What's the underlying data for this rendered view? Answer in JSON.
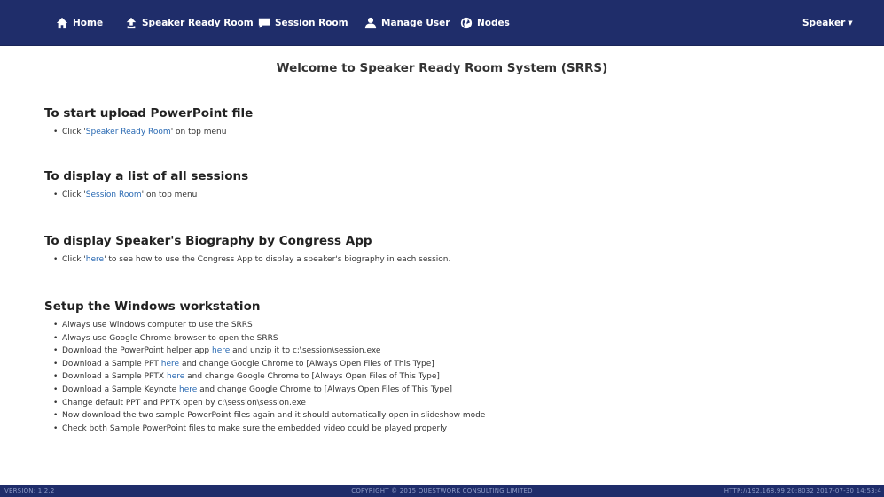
{
  "nav": {
    "home": "Home",
    "speaker_ready_room": "Speaker Ready Room",
    "session_room": "Session Room",
    "manage_user": "Manage User",
    "nodes": "Nodes",
    "user_menu": "Speaker"
  },
  "welcome": "Welcome to Speaker Ready Room System (SRRS)",
  "sections": {
    "upload": {
      "title": "To start upload PowerPoint file",
      "item_pre": "Click '",
      "item_link": "Speaker Ready Room",
      "item_post": "' on top menu"
    },
    "sessions": {
      "title": "To display a list of all sessions",
      "item_pre": "Click '",
      "item_link": "Session Room",
      "item_post": "' on top menu"
    },
    "biography": {
      "title": "To display Speaker's Biography by Congress App",
      "item_pre": "Click '",
      "item_link": "here",
      "item_post": "' to see how to use the Congress App to display a speaker's biography in each session."
    },
    "setup": {
      "title": "Setup the Windows workstation",
      "item1": "Always use Windows computer to use the SRRS",
      "item2": "Always use Google Chrome browser to open the SRRS",
      "item3_pre": "Download the PowerPoint helper app ",
      "item3_link": "here",
      "item3_post": " and unzip it to c:\\session\\session.exe",
      "item4_pre": "Download a Sample PPT ",
      "item4_link": "here",
      "item4_post": " and change Google Chrome to [Always Open Files of This Type]",
      "item5_pre": "Download a Sample PPTX ",
      "item5_link": "here",
      "item5_post": " and change Google Chrome to [Always Open Files of This Type]",
      "item6_pre": "Download a Sample Keynote ",
      "item6_link": "here",
      "item6_post": " and change Google Chrome to [Always Open Files of This Type]",
      "item7": "Change default PPT and PPTX open by c:\\session\\session.exe",
      "item8": "Now download the two sample PowerPoint files again and it should automatically open in slideshow mode",
      "item9": "Check both Sample PowerPoint files to make sure the embedded video could be played properly"
    }
  },
  "footer": {
    "version": "VERSION: 1.2.2",
    "copyright": "COPYRIGHT © 2015 QUESTWORK CONSULTING LIMITED",
    "url": "HTTP://192.168.99.20:8032 2017-07-30 14:53:4"
  },
  "colors": {
    "navbar": "#1f2d6a",
    "link": "#2a6ab3",
    "text": "#333333"
  },
  "icons": {
    "home": "home-icon",
    "speaker_ready_room": "upload-icon",
    "session_room": "comment-icon",
    "manage_user": "user-icon",
    "nodes": "globe-icon"
  }
}
